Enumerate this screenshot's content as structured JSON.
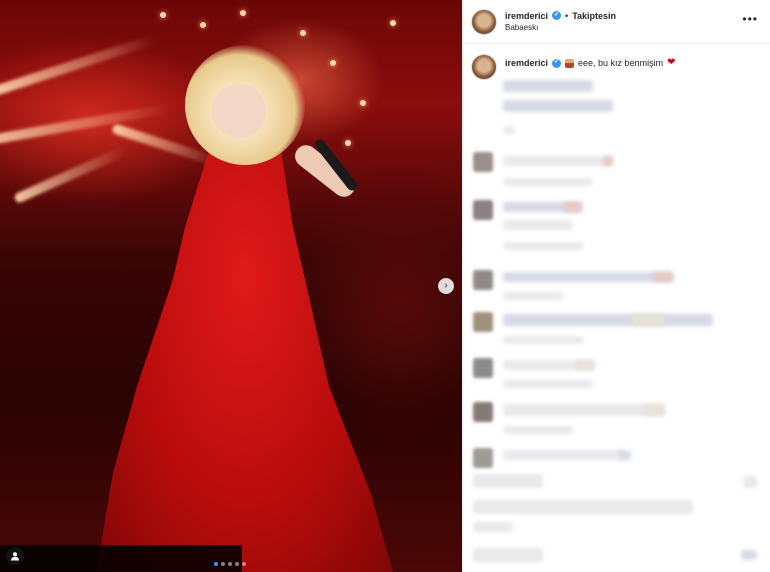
{
  "post": {
    "photo_alt": "",
    "carousel": {
      "count": 5,
      "active_index": 0
    }
  },
  "header": {
    "username": "iremderici",
    "separator": "•",
    "follow_status": "Takiptesin",
    "location": "Babaeskı",
    "more_icon": "more-horizontal-icon"
  },
  "caption": {
    "username": "iremderici",
    "text_start": "eee, bu kız benmişim",
    "emoji_person": "person-emoji",
    "heart": "❤"
  },
  "icons": {
    "next": "›",
    "verified": "✔",
    "tag_user": "user-tag-icon"
  },
  "colors": {
    "accent": "#3897f0",
    "heart": "#d0021b",
    "dress": "#c4100f"
  }
}
